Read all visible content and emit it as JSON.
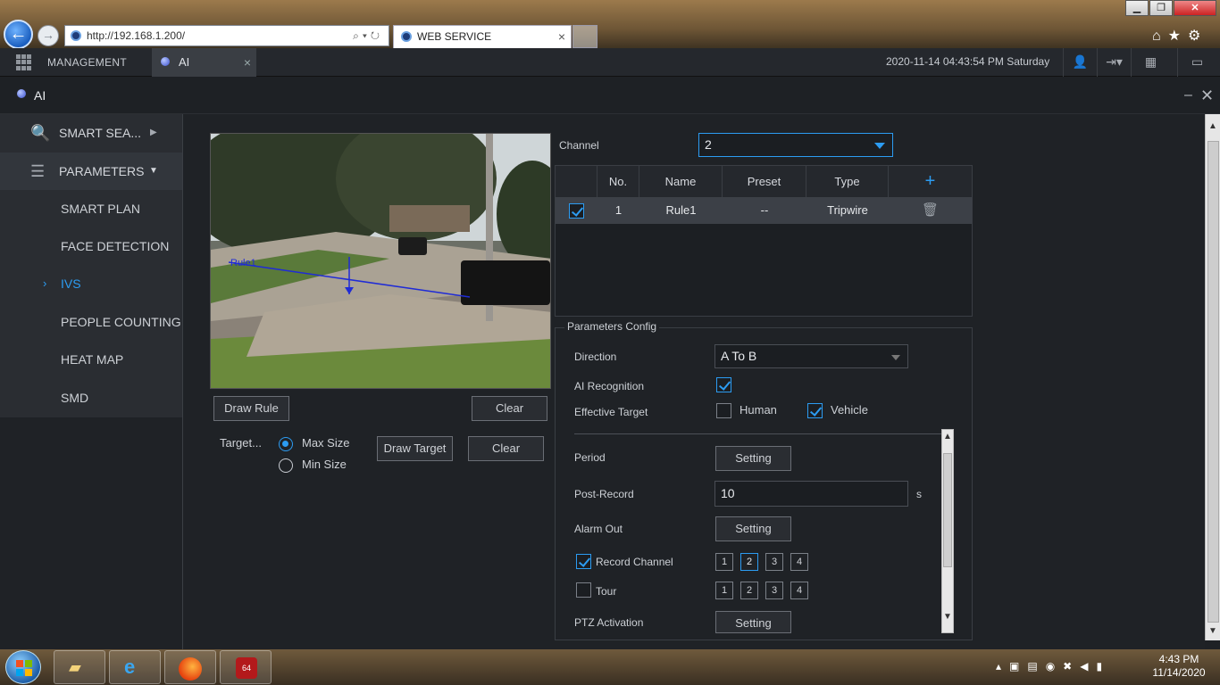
{
  "browser": {
    "url": "http://192.168.1.200/",
    "tab_title": "WEB SERVICE",
    "close_tab": "×"
  },
  "header": {
    "management": "MANAGEMENT",
    "tab_label": "AI",
    "tab_close": "×",
    "datetime": "2020-11-14 04:43:54 PM Saturday"
  },
  "module": {
    "title": "AI"
  },
  "sidebar": {
    "smart_search": "SMART SEA...",
    "parameters": "PARAMETERS",
    "items": [
      "SMART PLAN",
      "FACE DETECTION",
      "IVS",
      "PEOPLE COUNTING",
      "HEAT MAP",
      "SMD"
    ],
    "active": "IVS"
  },
  "preview": {
    "rule_overlay": "Rule1",
    "draw_rule": "Draw Rule",
    "clear": "Clear",
    "target_label": "Target...",
    "max_size": "Max Size",
    "min_size": "Min Size",
    "draw_target": "Draw Target",
    "clear2": "Clear"
  },
  "channel": {
    "label": "Channel",
    "value": "2"
  },
  "rules_table": {
    "headers": [
      "No.",
      "Name",
      "Preset",
      "Type"
    ],
    "add": "+",
    "rows": [
      {
        "no": "1",
        "name": "Rule1",
        "preset": "--",
        "type": "Tripwire"
      }
    ]
  },
  "params": {
    "title": "Parameters Config",
    "direction_label": "Direction",
    "direction_value": "A To B",
    "ai_recognition": "AI Recognition",
    "effective_target": "Effective Target",
    "human": "Human",
    "vehicle": "Vehicle",
    "period": "Period",
    "setting": "Setting",
    "post_record": "Post-Record",
    "post_record_value": "10",
    "post_record_unit": "s",
    "alarm_out": "Alarm Out",
    "record_channel": "Record Channel",
    "tour": "Tour",
    "ptz_activation": "PTZ Activation",
    "channels": [
      "1",
      "2",
      "3",
      "4"
    ]
  },
  "taskbar": {
    "time": "4:43 PM",
    "date": "11/14/2020"
  }
}
